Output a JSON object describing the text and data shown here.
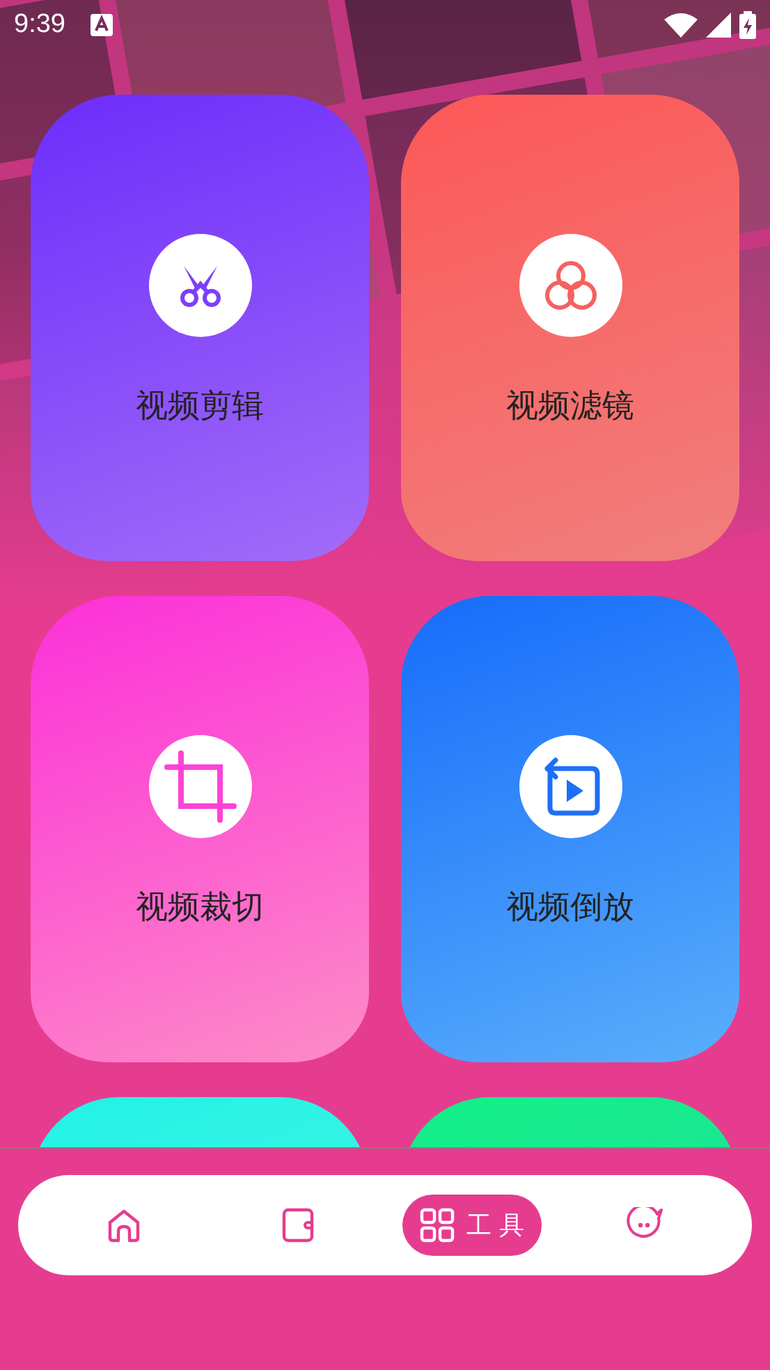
{
  "status_bar": {
    "time": "9:39"
  },
  "tools": [
    {
      "kind": "scissors",
      "label": "视频剪辑"
    },
    {
      "kind": "filter",
      "label": "视频滤镜"
    },
    {
      "kind": "crop",
      "label": "视频裁切"
    },
    {
      "kind": "reverse",
      "label": "视频倒放"
    },
    {
      "kind": "teal"
    },
    {
      "kind": "green"
    }
  ],
  "nav": [
    {
      "kind": "home",
      "selected": false
    },
    {
      "kind": "wallet",
      "selected": false
    },
    {
      "kind": "grid",
      "label": "工 具",
      "selected": true
    },
    {
      "kind": "face",
      "selected": false
    }
  ]
}
